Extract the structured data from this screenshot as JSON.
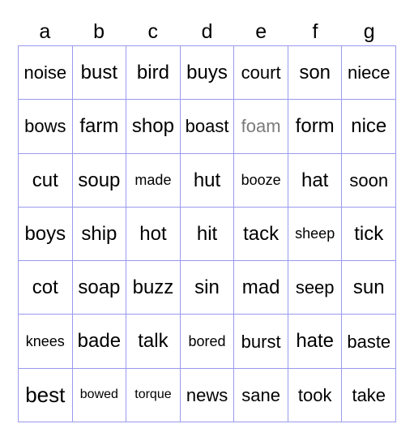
{
  "card": {
    "columns": [
      "a",
      "b",
      "c",
      "d",
      "e",
      "f",
      "g"
    ],
    "colors": {
      "grid_line": "#9999ee",
      "cell_background": "#ffffff",
      "text": "#000000",
      "marked_text": "#7a7a7a",
      "page_background": "#ffffff"
    },
    "rows": [
      [
        {
          "word": "noise",
          "size": "md",
          "marked": false
        },
        {
          "word": "bust",
          "size": "lg",
          "marked": false
        },
        {
          "word": "bird",
          "size": "lg",
          "marked": false
        },
        {
          "word": "buys",
          "size": "lg",
          "marked": false
        },
        {
          "word": "court",
          "size": "md",
          "marked": false
        },
        {
          "word": "son",
          "size": "lg",
          "marked": false
        },
        {
          "word": "niece",
          "size": "md",
          "marked": false
        }
      ],
      [
        {
          "word": "bows",
          "size": "md",
          "marked": false
        },
        {
          "word": "farm",
          "size": "lg",
          "marked": false
        },
        {
          "word": "shop",
          "size": "lg",
          "marked": false
        },
        {
          "word": "boast",
          "size": "md",
          "marked": false
        },
        {
          "word": "foam",
          "size": "md",
          "marked": true
        },
        {
          "word": "form",
          "size": "lg",
          "marked": false
        },
        {
          "word": "nice",
          "size": "lg",
          "marked": false
        }
      ],
      [
        {
          "word": "cut",
          "size": "lg",
          "marked": false
        },
        {
          "word": "soup",
          "size": "lg",
          "marked": false
        },
        {
          "word": "made",
          "size": "sm",
          "marked": false
        },
        {
          "word": "hut",
          "size": "lg",
          "marked": false
        },
        {
          "word": "booze",
          "size": "sm",
          "marked": false
        },
        {
          "word": "hat",
          "size": "lg",
          "marked": false
        },
        {
          "word": "soon",
          "size": "md",
          "marked": false
        }
      ],
      [
        {
          "word": "boys",
          "size": "lg",
          "marked": false
        },
        {
          "word": "ship",
          "size": "lg",
          "marked": false
        },
        {
          "word": "hot",
          "size": "lg",
          "marked": false
        },
        {
          "word": "hit",
          "size": "lg",
          "marked": false
        },
        {
          "word": "tack",
          "size": "lg",
          "marked": false
        },
        {
          "word": "sheep",
          "size": "sm",
          "marked": false
        },
        {
          "word": "tick",
          "size": "lg",
          "marked": false
        }
      ],
      [
        {
          "word": "cot",
          "size": "lg",
          "marked": false
        },
        {
          "word": "soap",
          "size": "lg",
          "marked": false
        },
        {
          "word": "buzz",
          "size": "lg",
          "marked": false
        },
        {
          "word": "sin",
          "size": "lg",
          "marked": false
        },
        {
          "word": "mad",
          "size": "lg",
          "marked": false
        },
        {
          "word": "seep",
          "size": "md",
          "marked": false
        },
        {
          "word": "sun",
          "size": "lg",
          "marked": false
        }
      ],
      [
        {
          "word": "knees",
          "size": "sm",
          "marked": false
        },
        {
          "word": "bade",
          "size": "lg",
          "marked": false
        },
        {
          "word": "talk",
          "size": "lg",
          "marked": false
        },
        {
          "word": "bored",
          "size": "sm",
          "marked": false
        },
        {
          "word": "burst",
          "size": "md",
          "marked": false
        },
        {
          "word": "hate",
          "size": "lg",
          "marked": false
        },
        {
          "word": "baste",
          "size": "md",
          "marked": false
        }
      ],
      [
        {
          "word": "best",
          "size": "xl",
          "marked": false
        },
        {
          "word": "bowed",
          "size": "xs",
          "marked": false
        },
        {
          "word": "torque",
          "size": "xs",
          "marked": false
        },
        {
          "word": "news",
          "size": "md",
          "marked": false
        },
        {
          "word": "sane",
          "size": "md",
          "marked": false
        },
        {
          "word": "took",
          "size": "md",
          "marked": false
        },
        {
          "word": "take",
          "size": "md",
          "marked": false
        }
      ]
    ]
  }
}
